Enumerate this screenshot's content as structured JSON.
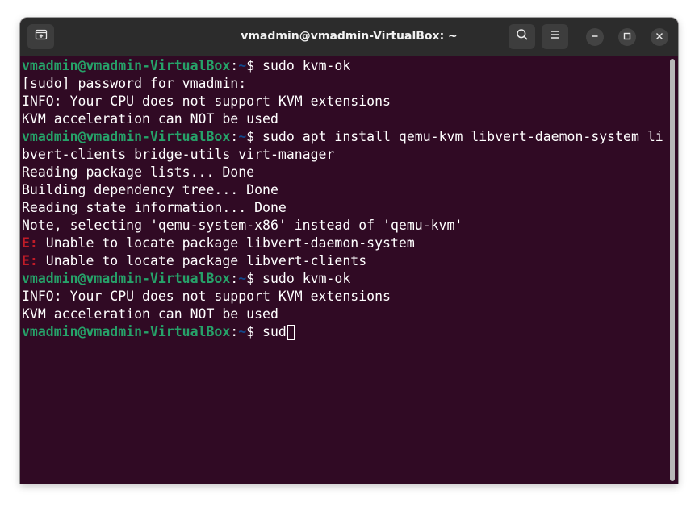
{
  "window": {
    "title": "vmadmin@vmadmin-VirtualBox: ~"
  },
  "toolbar": {
    "new_tab_icon": "new-tab-icon",
    "search_icon": "search-icon",
    "menu_icon": "hamburger-menu-icon",
    "minimize_icon": "minimize-icon",
    "maximize_icon": "maximize-icon",
    "close_icon": "close-icon"
  },
  "terminal": {
    "prompt_user": "vmadmin@vmadmin-VirtualBox",
    "prompt_colon": ":",
    "prompt_path": "~",
    "prompt_dollar": "$ ",
    "lines": [
      {
        "type": "prompt",
        "cmd": "sudo kvm-ok"
      },
      {
        "type": "out",
        "text": "[sudo] password for vmadmin:"
      },
      {
        "type": "out",
        "text": "INFO: Your CPU does not support KVM extensions"
      },
      {
        "type": "out",
        "text": "KVM acceleration can NOT be used"
      },
      {
        "type": "prompt",
        "cmd": "sudo apt install qemu-kvm libvert-daemon-system li"
      },
      {
        "type": "out",
        "text": "bvert-clients bridge-utils virt-manager"
      },
      {
        "type": "out",
        "text": "Reading package lists... Done"
      },
      {
        "type": "out",
        "text": "Building dependency tree... Done"
      },
      {
        "type": "out",
        "text": "Reading state information... Done"
      },
      {
        "type": "out",
        "text": "Note, selecting 'qemu-system-x86' instead of 'qemu-kvm'"
      },
      {
        "type": "error",
        "tag": "E:",
        "text": " Unable to locate package libvert-daemon-system"
      },
      {
        "type": "error",
        "tag": "E:",
        "text": " Unable to locate package libvert-clients"
      },
      {
        "type": "prompt",
        "cmd": "sudo kvm-ok"
      },
      {
        "type": "out",
        "text": "INFO: Your CPU does not support KVM extensions"
      },
      {
        "type": "out",
        "text": "KVM acceleration can NOT be used"
      },
      {
        "type": "prompt",
        "cmd": "sud",
        "cursor": true
      }
    ]
  },
  "colors": {
    "terminal_bg": "#300a24",
    "prompt_user": "#26a269",
    "prompt_path": "#12488b",
    "error": "#c01c28",
    "titlebar_bg": "#2c2c2c"
  }
}
